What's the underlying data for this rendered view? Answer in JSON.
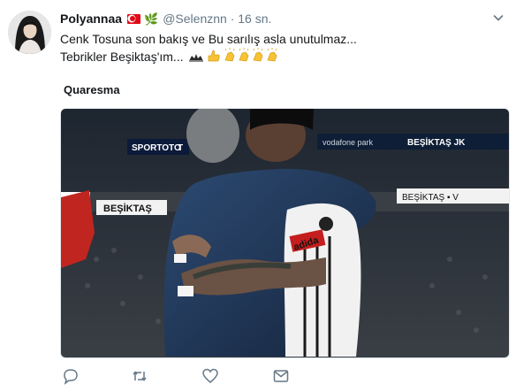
{
  "tweet": {
    "display_name": "Polyannaa",
    "handle": "@Selenznn",
    "separator": "·",
    "time": "16 sn.",
    "line1": "Cenk Tosuna son bakış ve Bu sarılış asla unutulmaz...",
    "line2": "Tebrikler Beşiktaş'ım...",
    "media_caption": "Quaresma"
  },
  "media": {
    "banner1": "SPORTOTO",
    "banner1b": "T",
    "banner2": "vodafone park",
    "banner3": "BEŞİKTAŞ JK",
    "board_left": "BEŞİKTAŞ",
    "board_right": "BEŞİKTAŞ ▪ V",
    "jersey": "adida"
  },
  "icons": [
    "avatar",
    "turkish-flag-icon",
    "olive-branch-icon",
    "chevron-down-icon",
    "eagle-emoji-icon",
    "thumbs-up-icon",
    "clapping-hands-icon",
    "reply-icon",
    "retweet-icon",
    "like-icon",
    "direct-message-icon"
  ],
  "colors": {
    "accent": "#14171a",
    "muted": "#657786",
    "clap": "#f7c234"
  }
}
